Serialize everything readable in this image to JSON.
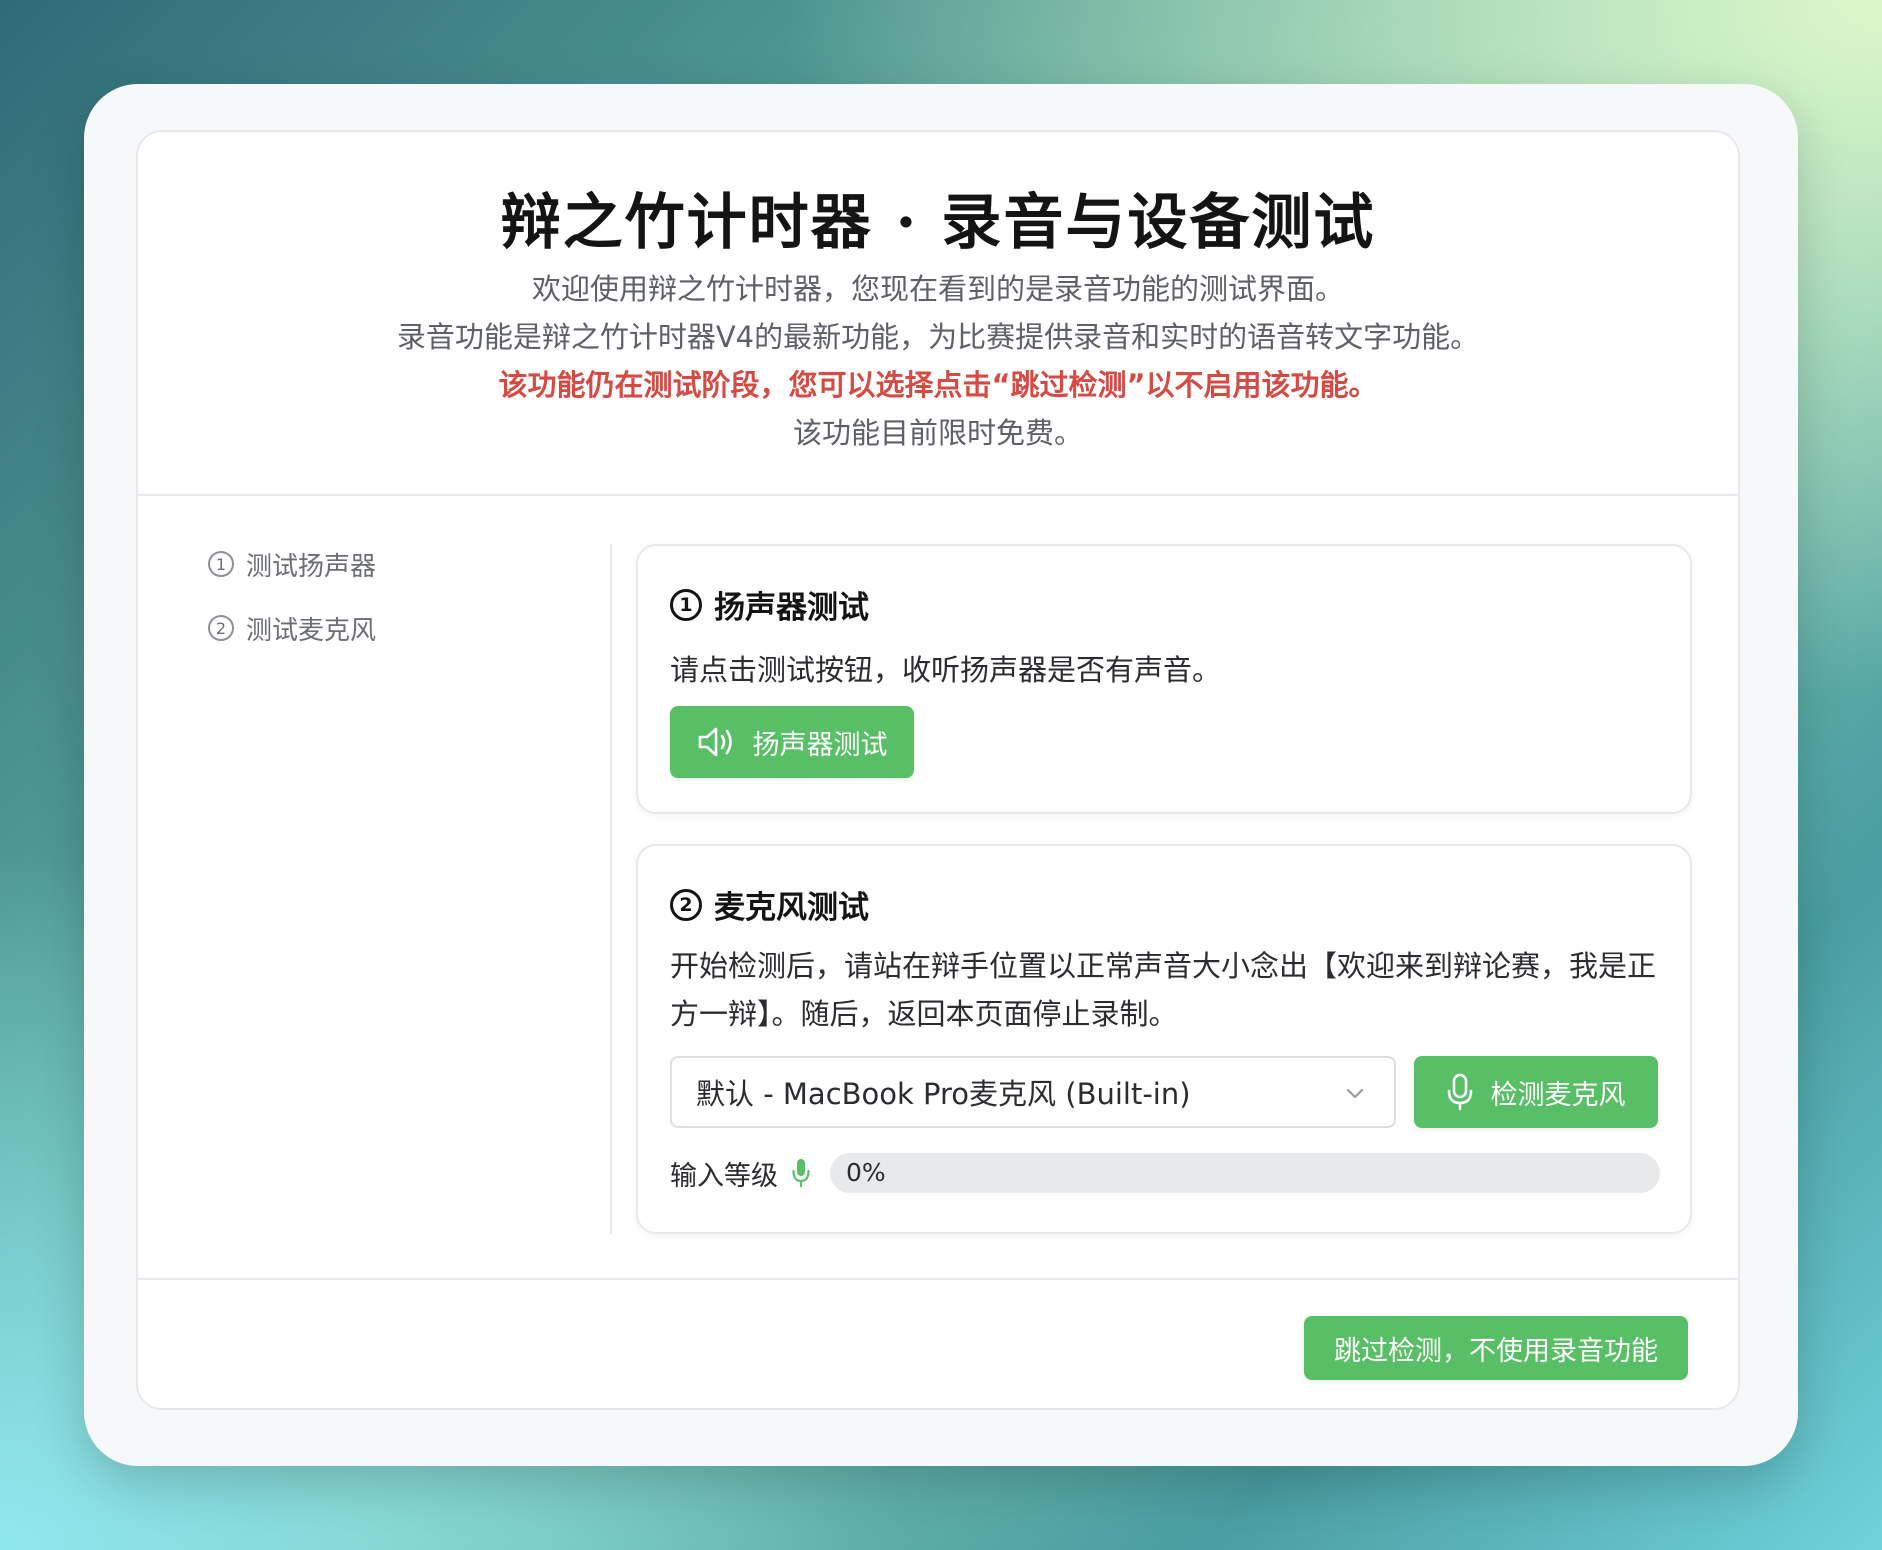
{
  "header": {
    "title": "辩之竹计时器 · 录音与设备测试",
    "line1": "欢迎使用辩之竹计时器，您现在看到的是录音功能的测试界面。",
    "line2": "录音功能是辩之竹计时器V4的最新功能，为比赛提供录音和实时的语音转文字功能。",
    "warning": "该功能仍在测试阶段，您可以选择点击“跳过检测”以不启用该功能。",
    "line4": "该功能目前限时免费。"
  },
  "steps": [
    {
      "num": "1",
      "label": "测试扬声器"
    },
    {
      "num": "2",
      "label": "测试麦克风"
    }
  ],
  "speaker_panel": {
    "num": "1",
    "title": "扬声器测试",
    "desc": "请点击测试按钮，收听扬声器是否有声音。",
    "button": "扬声器测试",
    "icon": "speaker-icon"
  },
  "mic_panel": {
    "num": "2",
    "title": "麦克风测试",
    "desc": "开始检测后，请站在辩手位置以正常声音大小念出【欢迎来到辩论赛，我是正方一辩】。随后，返回本页面停止录制。",
    "device_selected": "默认 - MacBook Pro麦克风 (Built-in)",
    "button": "检测麦克风",
    "level_label": "输入等级",
    "level_value": 0,
    "level_text": "0%"
  },
  "footer": {
    "skip_button": "跳过检测，不使用录音功能"
  },
  "colors": {
    "accent": "#58bf66",
    "warning": "#d54a43"
  }
}
